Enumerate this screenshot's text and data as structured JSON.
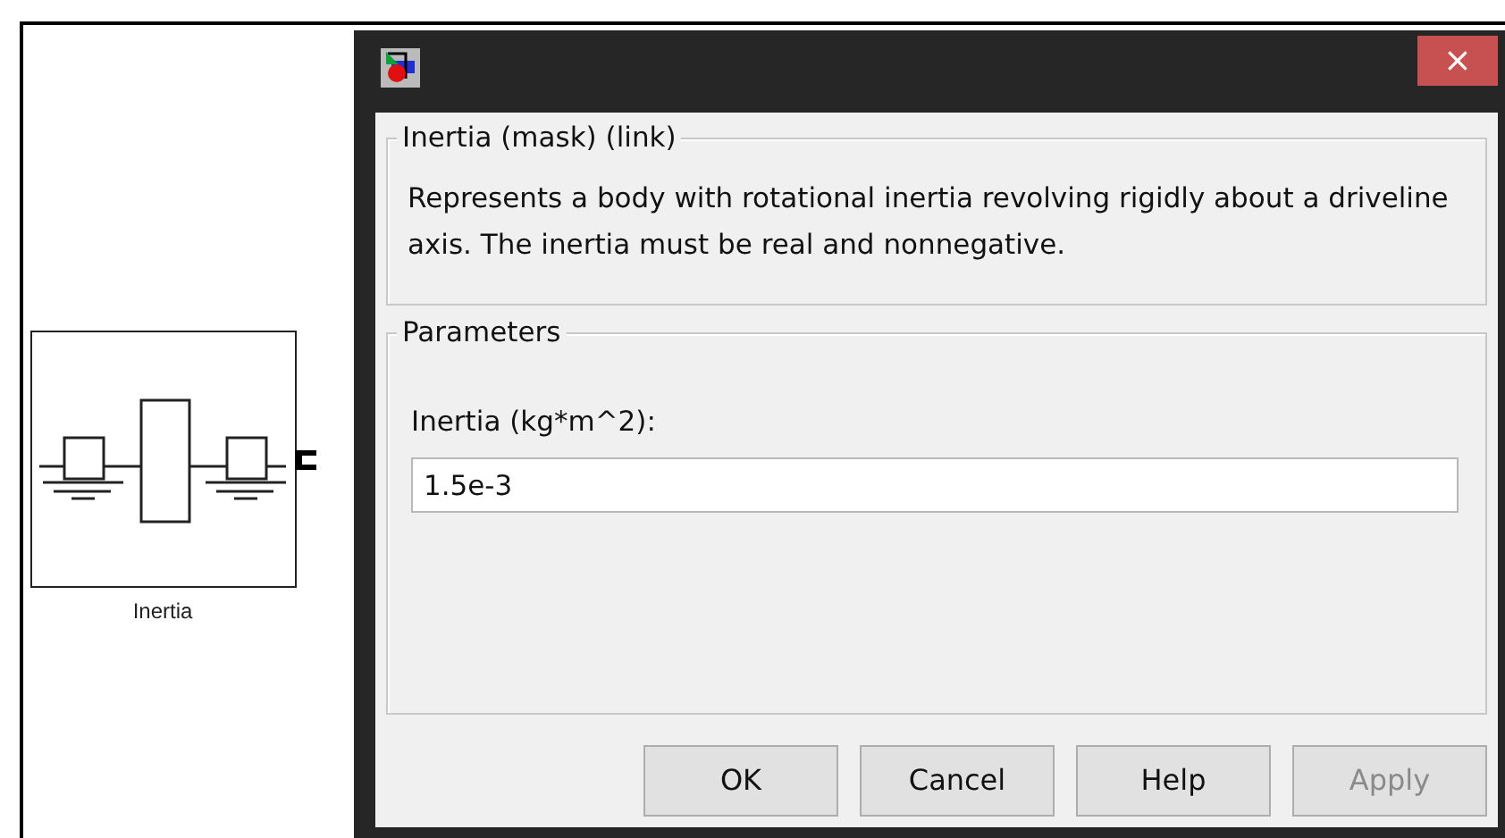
{
  "canvas": {
    "block": {
      "label": "Inertia"
    }
  },
  "dialog": {
    "close": "×",
    "description_group": {
      "title": "Inertia (mask) (link)",
      "text": "Represents a body with rotational inertia revolving rigidly about a driveline axis. The inertia must be real and nonnegative."
    },
    "parameters_group": {
      "title": "Parameters",
      "field_label": "Inertia (kg*m^2):",
      "value": "1.5e-3"
    },
    "buttons": [
      {
        "label": "OK",
        "disabled": false
      },
      {
        "label": "Cancel",
        "disabled": false
      },
      {
        "label": "Help",
        "disabled": false
      },
      {
        "label": "Apply",
        "disabled": true
      }
    ]
  }
}
